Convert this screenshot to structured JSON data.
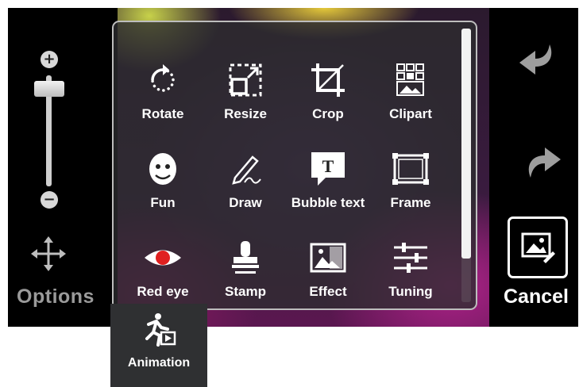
{
  "left_panel": {
    "options_label": "Options"
  },
  "right_panel": {
    "cancel_label": "Cancel"
  },
  "tools": [
    {
      "label": "Rotate",
      "icon": "rotate-icon"
    },
    {
      "label": "Resize",
      "icon": "resize-icon"
    },
    {
      "label": "Crop",
      "icon": "crop-icon"
    },
    {
      "label": "Clipart",
      "icon": "clipart-icon"
    },
    {
      "label": "Fun",
      "icon": "fun-face-icon"
    },
    {
      "label": "Draw",
      "icon": "draw-pen-icon"
    },
    {
      "label": "Bubble text",
      "icon": "bubble-text-icon"
    },
    {
      "label": "Frame",
      "icon": "frame-icon"
    },
    {
      "label": "Red eye",
      "icon": "red-eye-icon"
    },
    {
      "label": "Stamp",
      "icon": "stamp-icon"
    },
    {
      "label": "Effect",
      "icon": "effect-icon"
    },
    {
      "label": "Tuning",
      "icon": "tuning-icon"
    }
  ],
  "extra_tool": {
    "label": "Animation",
    "icon": "animation-icon"
  },
  "colors": {
    "red_eye": "#e02020",
    "menu_border": "#bdbdbd",
    "label_dim": "#9a9a9a"
  }
}
